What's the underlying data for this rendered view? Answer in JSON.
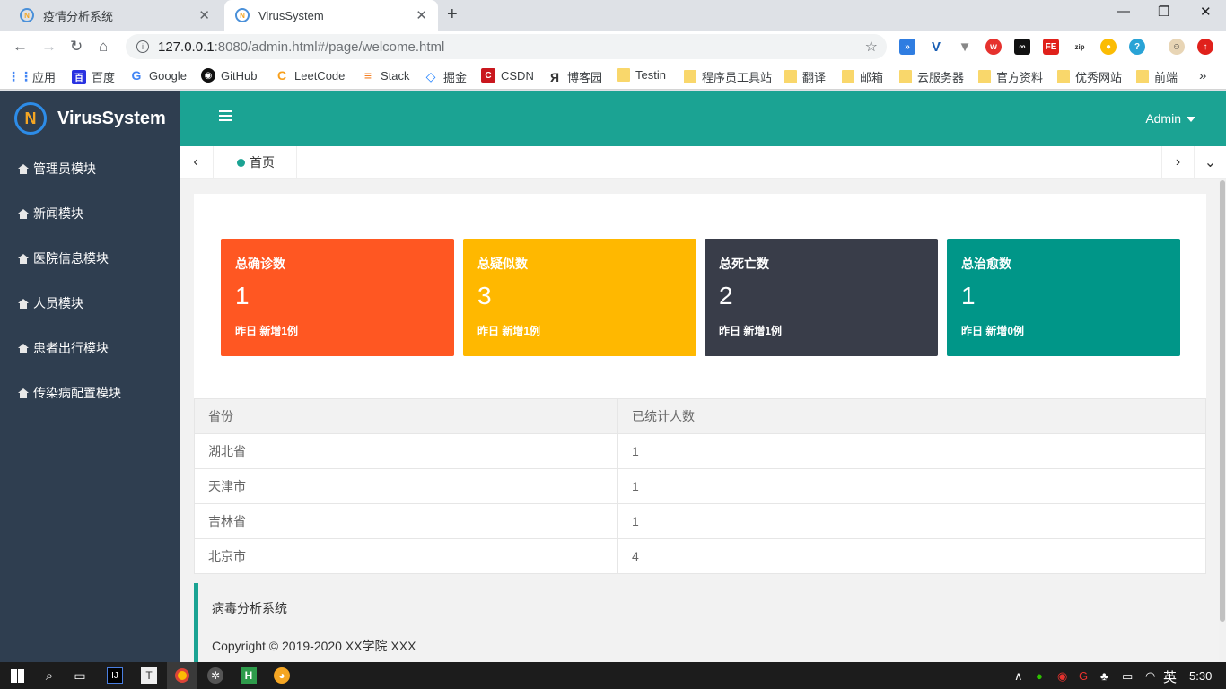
{
  "browser": {
    "tabs": [
      {
        "title": "疫情分析系统",
        "active": false
      },
      {
        "title": "VirusSystem",
        "active": true
      }
    ],
    "url_host": "127.0.0.1",
    "url_rest": ":8080/admin.html#/page/welcome.html",
    "bookmarks": [
      "应用",
      "百度",
      "Google",
      "GitHub",
      "LeetCode",
      "Stack",
      "掘金",
      "CSDN",
      "博客园",
      "Testin",
      "程序员工具站",
      "翻译",
      "邮箱",
      "云服务器",
      "官方资料",
      "优秀网站",
      "前端"
    ]
  },
  "app": {
    "logo": "VirusSystem",
    "user": "Admin",
    "sidebar": [
      "管理员模块",
      "新闻模块",
      "医院信息模块",
      "人员模块",
      "患者出行模块",
      "传染病配置模块"
    ],
    "home_tab": "首页",
    "accent": "#1ba393"
  },
  "cards": [
    {
      "title": "总确诊数",
      "value": "1",
      "note": "昨日 新增1例",
      "color": "#ff5722"
    },
    {
      "title": "总疑似数",
      "value": "3",
      "note": "昨日 新增1例",
      "color": "#ffb800"
    },
    {
      "title": "总死亡数",
      "value": "2",
      "note": "昨日 新增1例",
      "color": "#393d49"
    },
    {
      "title": "总治愈数",
      "value": "1",
      "note": "昨日 新增0例",
      "color": "#009688"
    }
  ],
  "table": {
    "headers": [
      "省份",
      "已统计人数"
    ],
    "rows": [
      [
        "湖北省",
        "1"
      ],
      [
        "天津市",
        "1"
      ],
      [
        "吉林省",
        "1"
      ],
      [
        "北京市",
        "4"
      ]
    ]
  },
  "footer": {
    "line1": "病毒分析系统",
    "line2": "Copyright © 2019-2020  XX学院 XXX"
  },
  "taskbar": {
    "ime": "英",
    "time": "5:30"
  }
}
